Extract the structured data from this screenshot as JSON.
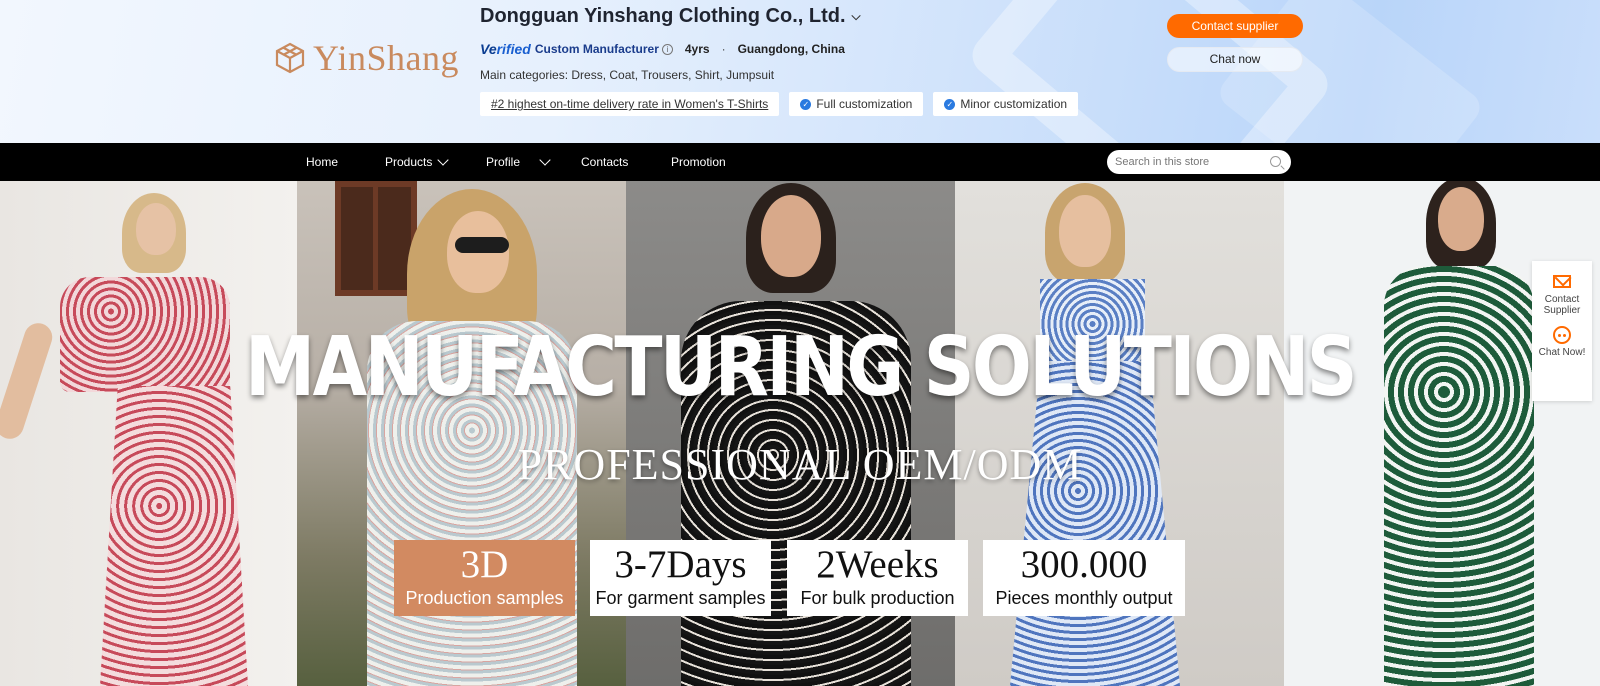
{
  "header": {
    "logo_text": "YinShang",
    "company_name": "Dongguan Yinshang Clothing Co., Ltd.",
    "verified_label": "Verified",
    "verified_accent": "Ve",
    "verified_rest": "rified",
    "manufacturer_type": "Custom Manufacturer",
    "years": "4yrs",
    "separator": "·",
    "location": "Guangdong, China",
    "main_categories": "Main categories: Dress, Coat, Trousers, Shirt, Jumpsuit",
    "tags": [
      {
        "label": "#2 highest on-time delivery rate in Women's T-Shirts"
      },
      {
        "label": "Full customization"
      },
      {
        "label": "Minor customization"
      }
    ],
    "contact_button": "Contact supplier",
    "chat_button": "Chat now"
  },
  "nav": {
    "items": [
      {
        "label": "Home"
      },
      {
        "label": "Products"
      },
      {
        "label": "Profile"
      },
      {
        "label": "Contacts"
      },
      {
        "label": "Promotion"
      }
    ],
    "search_placeholder": "Search in this store"
  },
  "banner": {
    "headline": "MANUFACTURING SOLUTIONS",
    "subheadline": "PROFESSIONAL OEM/ODM",
    "stats": [
      {
        "value": "3D",
        "label": "Production samples"
      },
      {
        "value": "3-7Days",
        "label": "For garment samples"
      },
      {
        "value": "2Weeks",
        "label": "For bulk production"
      },
      {
        "value": "300.000",
        "label": "Pieces monthly output"
      }
    ]
  },
  "side_float": {
    "contact_label_1": "Contact",
    "contact_label_2": "Supplier",
    "chat_label": "Chat Now!"
  },
  "colors": {
    "accent_orange": "#ff6a00",
    "stat_accent": "#d28a61",
    "nav_bg": "#000000",
    "logo_color": "#c98a5e"
  }
}
